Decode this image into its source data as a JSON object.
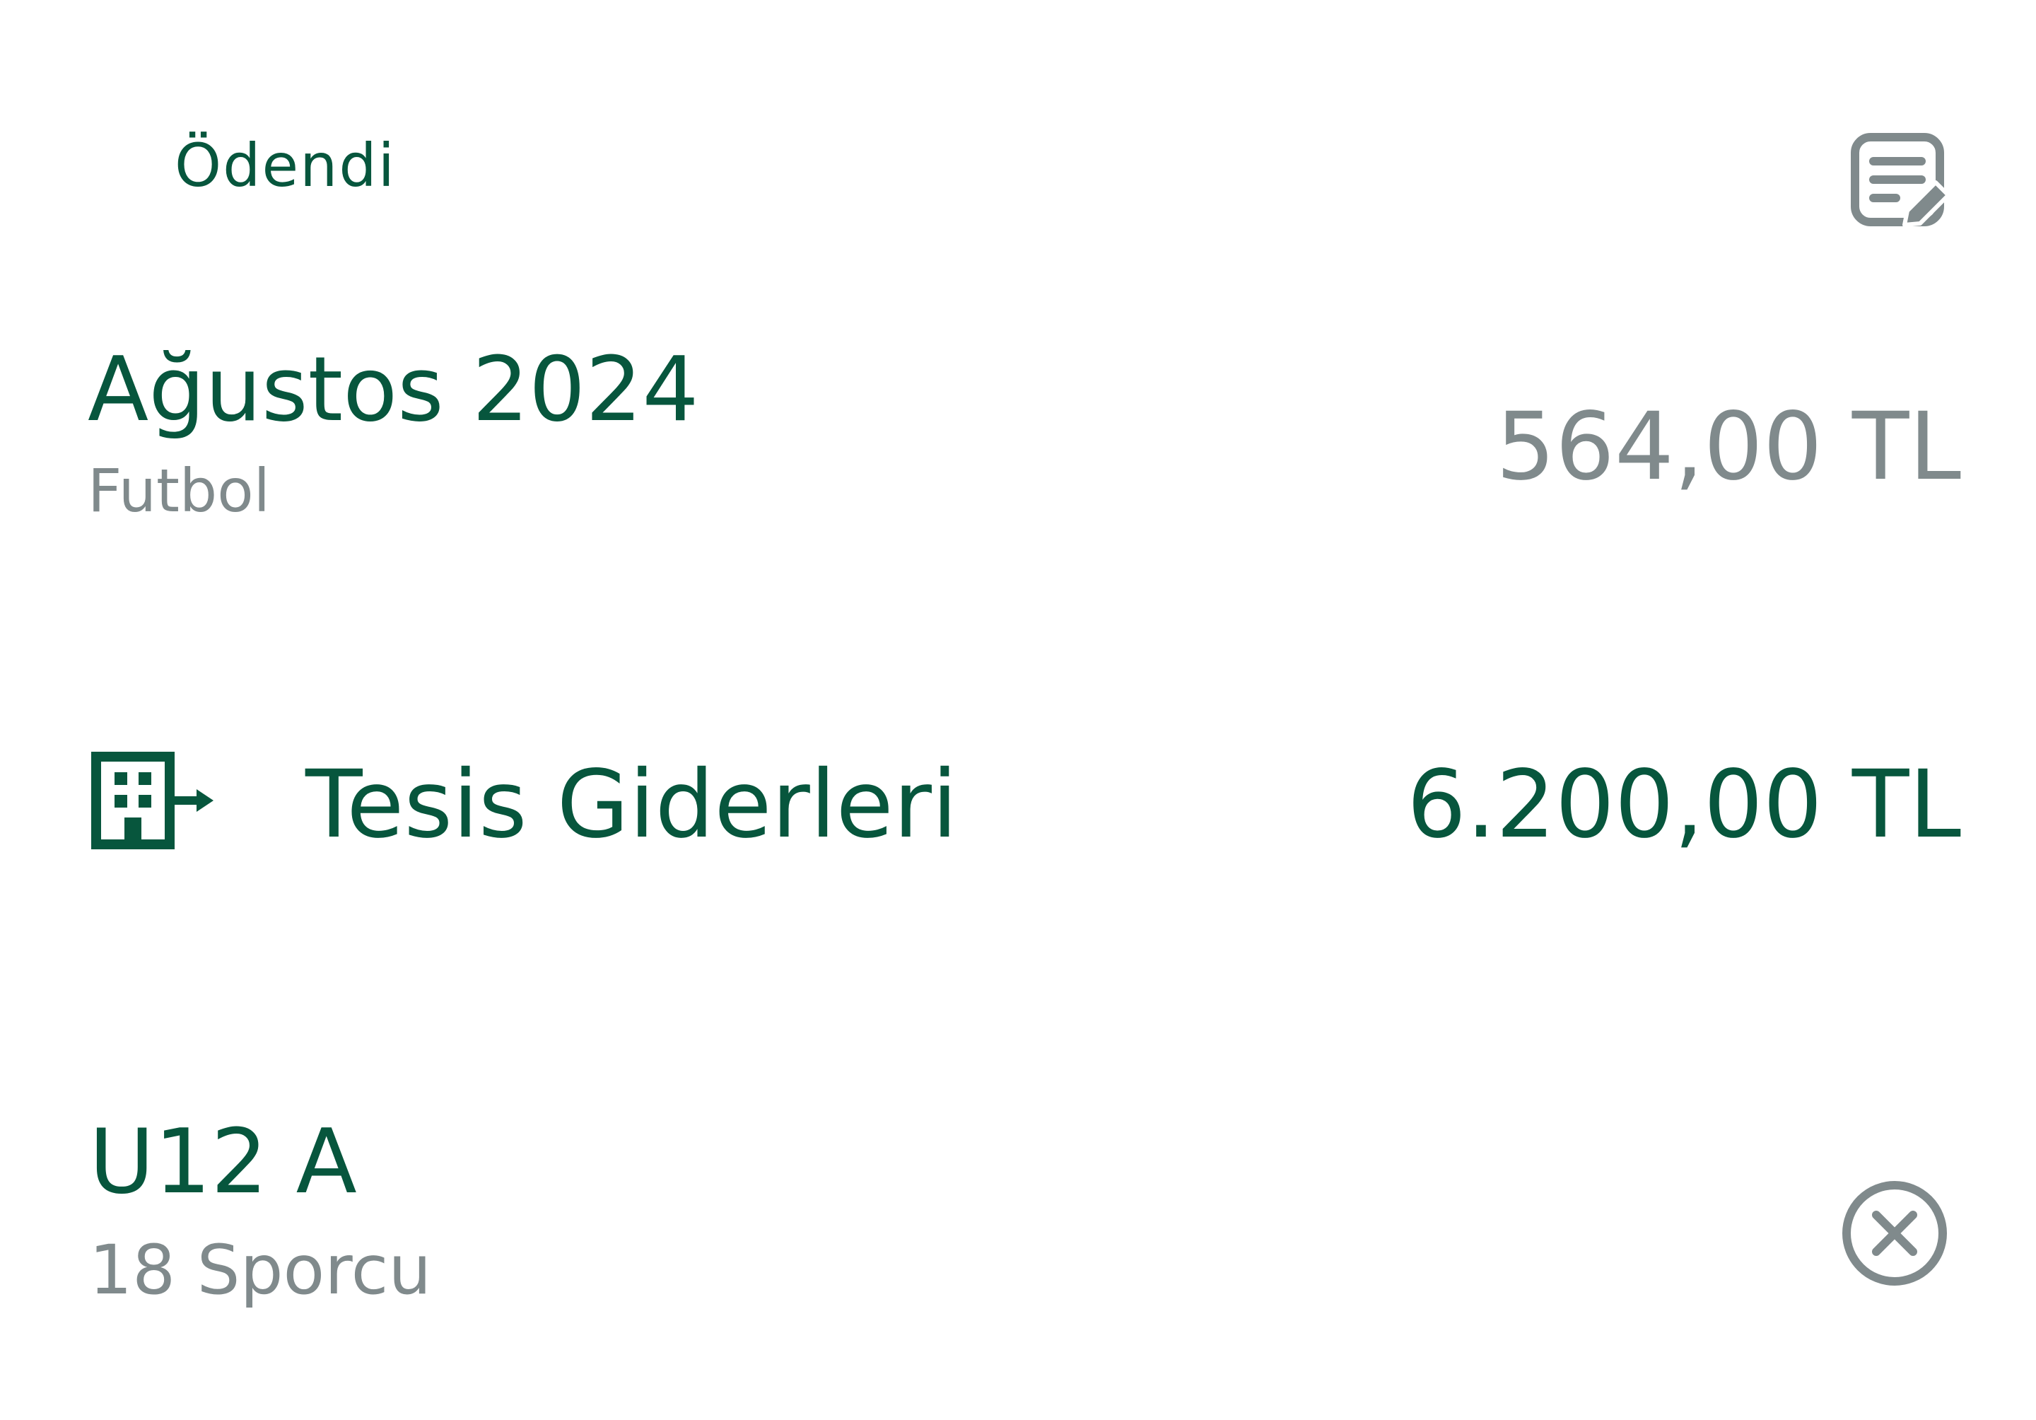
{
  "status": {
    "label": "Ödendi"
  },
  "actions": {
    "edit_icon": "edit-note-icon",
    "remove_icon": "close-circle-icon"
  },
  "period": {
    "title": "Ağustos 2024",
    "subtitle": "Futbol",
    "amount": "564,00 TL"
  },
  "category": {
    "icon": "building-exit-icon",
    "label": "Tesis Giderleri",
    "amount": "6.200,00 TL"
  },
  "team": {
    "title": "U12 A",
    "subtitle": "18 Sporcu"
  },
  "colors": {
    "primary": "#07563d",
    "muted": "#808a8c",
    "background": "#ffffff"
  }
}
